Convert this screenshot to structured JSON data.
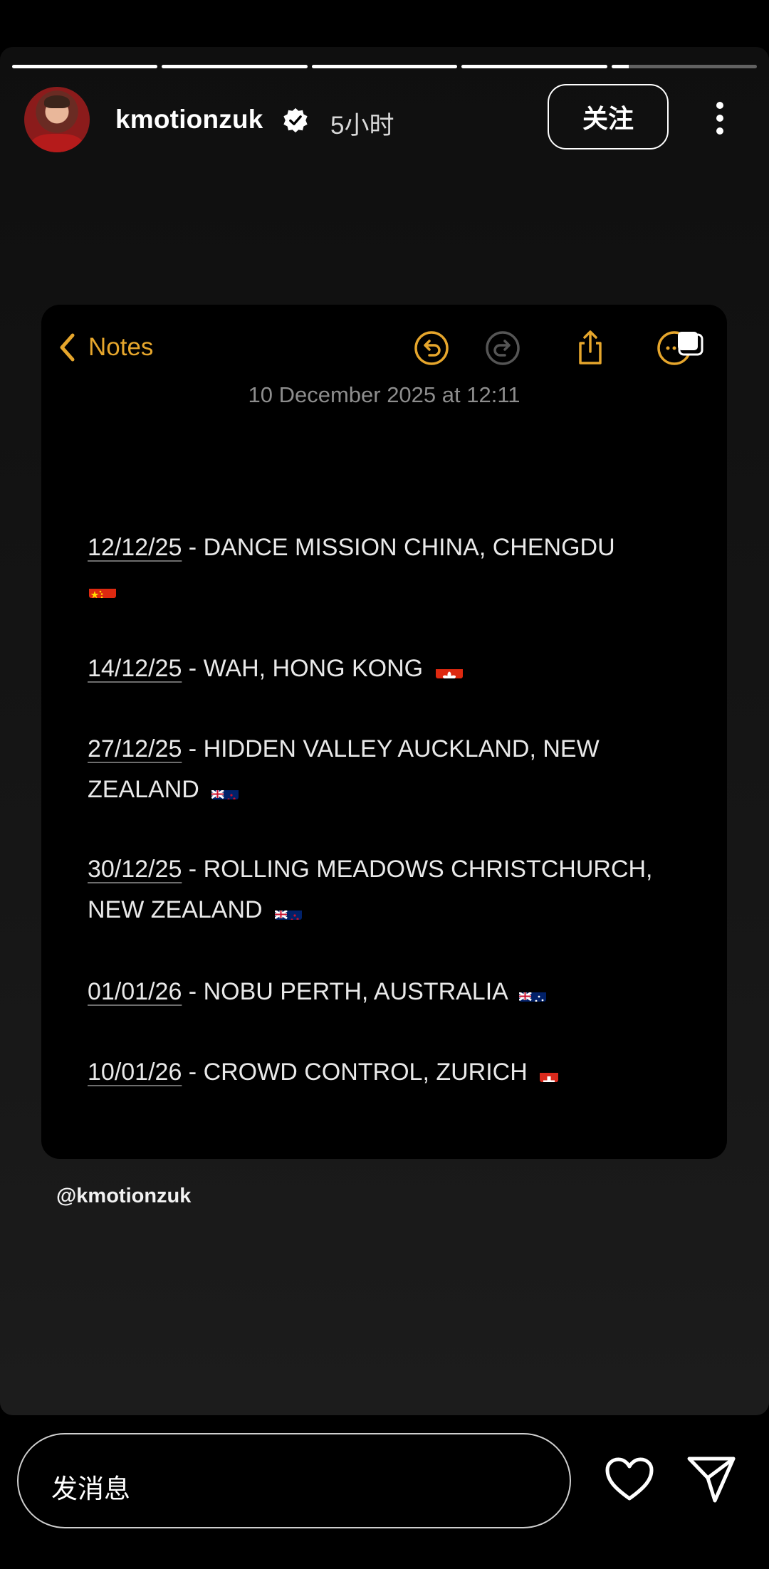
{
  "story": {
    "progress": [
      1,
      1,
      1,
      1,
      0.12
    ],
    "header": {
      "username": "kmotionzuk",
      "verified": true,
      "time_ago": "5小时",
      "follow_label": "关注",
      "more_icon": "more-vertical-icon"
    },
    "note": {
      "back_label": "Notes",
      "toolbar_icons": [
        "undo-icon",
        "redo-icon",
        "share-icon",
        "more-circle-icon"
      ],
      "accent_color": "#e6a62c",
      "date": "10 December 2025 at 12:11",
      "entries": [
        {
          "date": "12/12/25",
          "text": " - DANCE MISSION CHINA, CHENGDU",
          "flag": "flag-china-icon"
        },
        {
          "date": "14/12/25",
          "text": " - WAH, HONG KONG ",
          "flag": "flag-hong-kong-icon"
        },
        {
          "date": "27/12/25",
          "text": " - HIDDEN VALLEY AUCKLAND, NEW ZEALAND",
          "flag": "flag-new-zealand-icon"
        },
        {
          "date": "30/12/25",
          "text": " - ROLLING MEADOWS CHRISTCHURCH, NEW ZEALAND",
          "flag": "flag-new-zealand-icon"
        },
        {
          "date": "01/01/26",
          "text": " - NOBU PERTH, AUSTRALIA",
          "flag": "flag-australia-icon"
        },
        {
          "date": "10/01/26",
          "text": " - CROWD CONTROL, ZURICH ",
          "flag": "flag-switzerland-icon"
        }
      ]
    },
    "mention": "@kmotionzuk"
  },
  "footer": {
    "message_placeholder": "发消息",
    "like_icon": "heart-icon",
    "send_icon": "send-icon"
  }
}
